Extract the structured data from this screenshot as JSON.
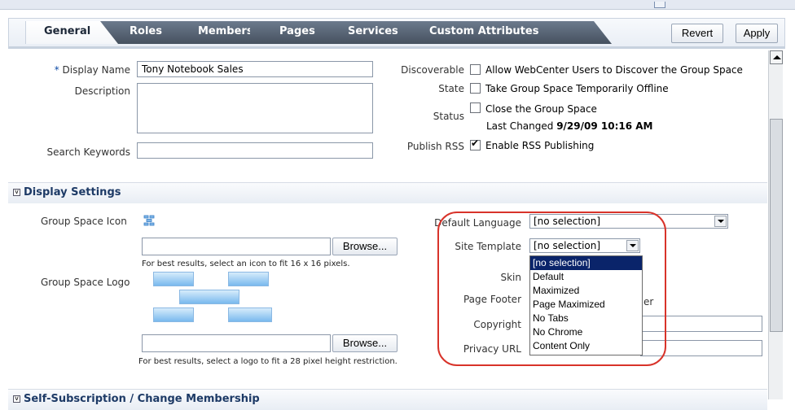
{
  "tabs": [
    {
      "label": "General",
      "active": true
    },
    {
      "label": "Roles"
    },
    {
      "label": "Members"
    },
    {
      "label": "Pages"
    },
    {
      "label": "Services"
    },
    {
      "label": "Custom Attributes"
    }
  ],
  "toolbar": {
    "revert_label": "Revert",
    "apply_label": "Apply"
  },
  "general": {
    "display_name_label": "Display Name",
    "required_mark": "*",
    "display_name_value": "Tony Notebook Sales",
    "description_label": "Description",
    "search_keywords_label": "Search Keywords",
    "discoverable_label": "Discoverable",
    "discoverable_text": "Allow WebCenter Users to Discover the Group Space",
    "state_label": "State",
    "state_text": "Take Group Space Temporarily Offline",
    "status_label": "Status",
    "status_text": "Close the Group Space",
    "last_changed_label": "Last Changed",
    "last_changed_value": "9/29/09 10:16 AM",
    "publish_rss_label": "Publish RSS",
    "publish_rss_text": "Enable RSS Publishing"
  },
  "display_settings": {
    "title": "Display Settings",
    "icon_label": "Group Space Icon",
    "browse_label": "Browse...",
    "icon_hint": "For best results, select an icon to fit 16 x 16 pixels.",
    "logo_label": "Group Space Logo",
    "logo_hint": "For best results, select a logo to fit a 28 pixel height restriction.",
    "default_language_label": "Default Language",
    "default_language_value": "[no selection]",
    "site_template_label": "Site Template",
    "site_template_value": "[no selection]",
    "skin_label": "Skin",
    "page_footer_label": "Page Footer",
    "page_footer_partial": "er",
    "copyright_label": "Copyright",
    "privacy_url_label": "Privacy URL",
    "site_template_options": [
      "[no selection]",
      "Default",
      "Maximized",
      "Page Maximized",
      "No Tabs",
      "No Chrome",
      "Content Only"
    ]
  },
  "next_section": {
    "title": "Self-Subscription / Change Membership"
  },
  "colors": {
    "highlight": "#d8332a",
    "selected_option": "#0a246a"
  }
}
